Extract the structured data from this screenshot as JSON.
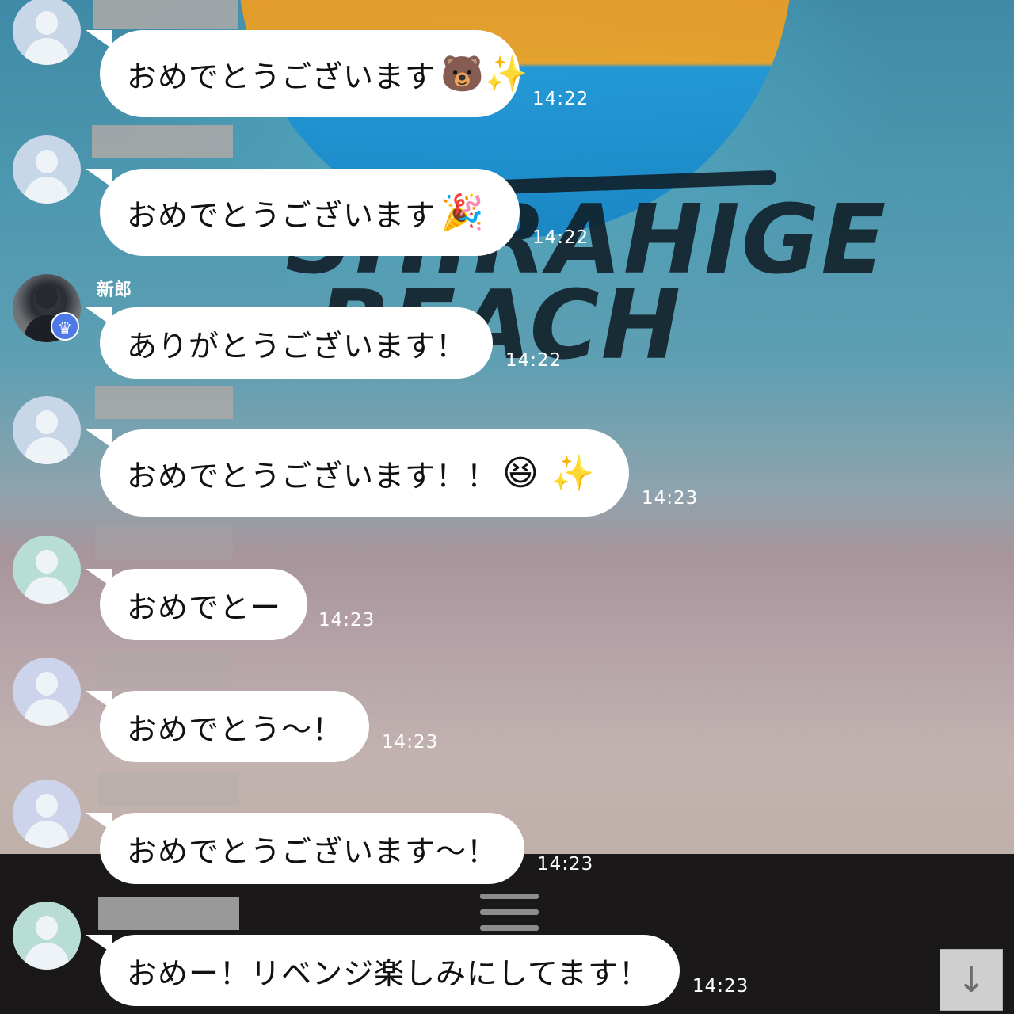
{
  "background": {
    "logo_text": [
      "SHIRAHIGE",
      "BEACH"
    ]
  },
  "messages": [
    {
      "sender": "",
      "text": "おめでとうございます",
      "emoji": "🐻✨",
      "time": "14:22"
    },
    {
      "sender": "",
      "text": "おめでとうございます",
      "emoji": "🎉",
      "time": "14:22"
    },
    {
      "sender": "新郎",
      "text": "ありがとうございます！",
      "emoji": "",
      "time": "14:22",
      "badge": "crown-icon"
    },
    {
      "sender": "",
      "text": "おめでとうございます！！",
      "emoji": "😆 ✨",
      "time": "14:23"
    },
    {
      "sender": "",
      "text": "おめでとー",
      "emoji": "",
      "time": "14:23"
    },
    {
      "sender": "",
      "text": "おめでとう〜！",
      "emoji": "",
      "time": "14:23"
    },
    {
      "sender": "",
      "text": "おめでとうございます〜！",
      "emoji": "",
      "time": "14:23"
    },
    {
      "sender": "",
      "text": "おめー！リベンジ楽しみにしてます！",
      "emoji": "",
      "time": "14:23"
    }
  ],
  "icons": {
    "scroll_down": "↓",
    "crown": "♛"
  }
}
